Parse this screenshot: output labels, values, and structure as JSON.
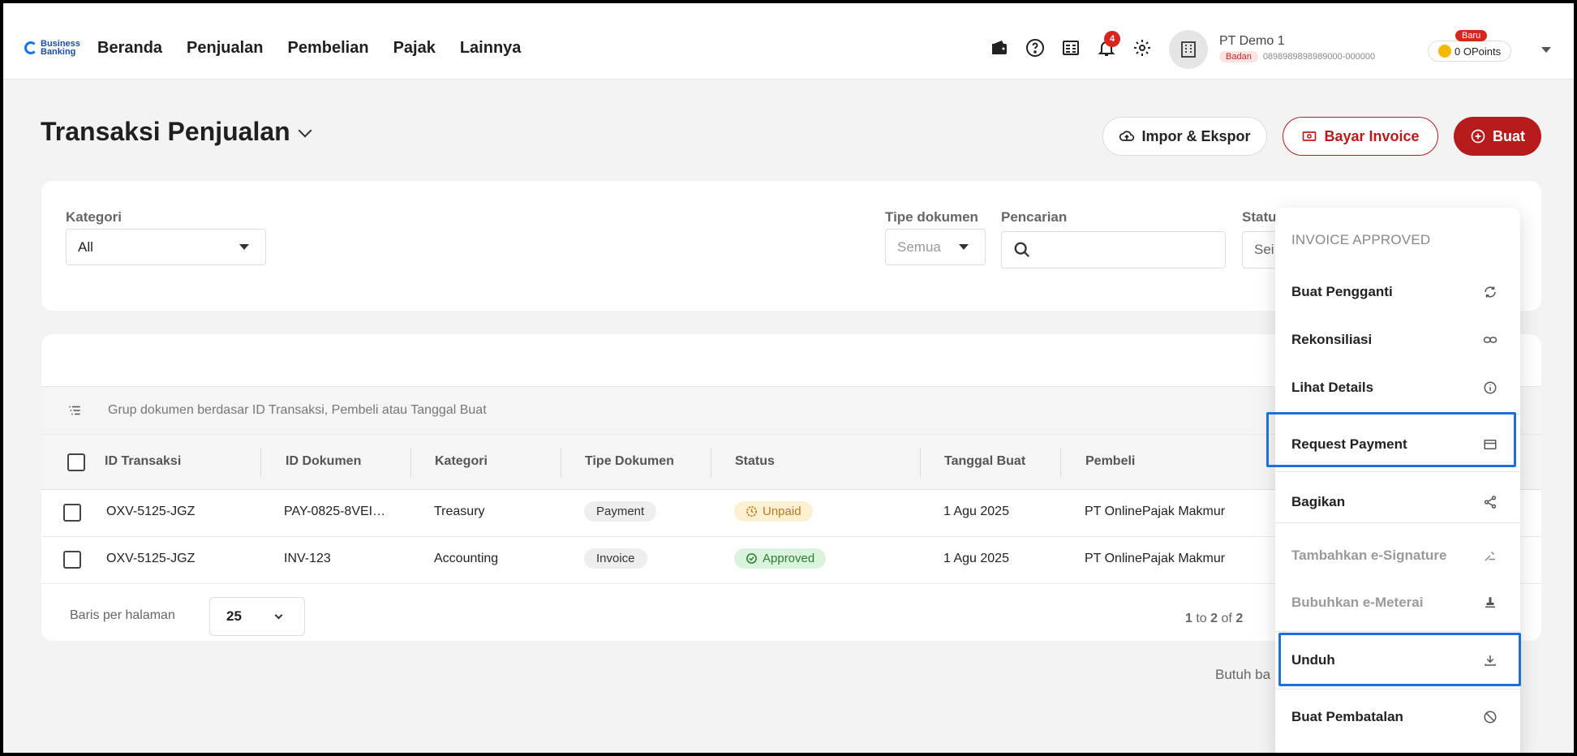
{
  "topbar": {
    "logo_line1": "Business",
    "logo_line2": "Banking",
    "nav": [
      "Beranda",
      "Penjualan",
      "Pembelian",
      "Pajak",
      "Lainnya"
    ],
    "notification_count": "4",
    "company_name": "PT Demo 1",
    "company_badge": "Badan",
    "company_npwp": "0898989898989000-000000",
    "points_badge": "Baru",
    "points_label": "0 OPoints"
  },
  "header": {
    "title": "Transaksi Penjualan",
    "impor_label": "Impor & Ekspor",
    "bayar_label": "Bayar Invoice",
    "buat_label": "Buat"
  },
  "filters": {
    "kategori_label": "Kategori",
    "kategori_value": "All",
    "tipe_label": "Tipe dokumen",
    "tipe_value": "Semua",
    "pencarian_label": "Pencarian",
    "pencarian_value": "",
    "status_label": "Statu",
    "status_value": "Sei"
  },
  "table": {
    "group_text": "Grup dokumen berdasar ID Transaksi, Pembeli atau Tanggal Buat",
    "headers": [
      "ID Transaksi",
      "ID Dokumen",
      "Kategori",
      "Tipe Dokumen",
      "Status",
      "Tanggal Buat",
      "Pembeli"
    ],
    "rows": [
      {
        "id_transaksi": "OXV-5125-JGZ",
        "id_dokumen": "PAY-0825-8VEI…",
        "kategori": "Treasury",
        "tipe": "Payment",
        "status": "Unpaid",
        "tanggal": "1 Agu 2025",
        "pembeli": "PT OnlinePajak Makmur"
      },
      {
        "id_transaksi": "OXV-5125-JGZ",
        "id_dokumen": "INV-123",
        "kategori": "Accounting",
        "tipe": "Invoice",
        "status": "Approved",
        "tanggal": "1 Agu 2025",
        "pembeli": "PT OnlinePajak Makmur"
      }
    ],
    "per_page_label": "Baris per halaman",
    "per_page_value": "25",
    "pager_from": "1",
    "pager_to": "2",
    "pager_total": "2",
    "pager_to_word": "to",
    "pager_of_word": "of"
  },
  "butuh_text": "Butuh ba",
  "menu": {
    "header": "INVOICE APPROVED",
    "items": [
      {
        "label": "Buat Pengganti",
        "icon": "refresh-icon"
      },
      {
        "label": "Rekonsiliasi",
        "icon": "link-icon"
      },
      {
        "label": "Lihat Details",
        "icon": "info-icon"
      },
      {
        "label": "Request Payment",
        "icon": "card-icon"
      },
      {
        "label": "Bagikan",
        "icon": "share-icon"
      },
      {
        "label": "Tambahkan e-Signature",
        "icon": "signature-icon"
      },
      {
        "label": "Bubuhkan e-Meterai",
        "icon": "stamp-icon"
      },
      {
        "label": "Unduh",
        "icon": "download-icon"
      },
      {
        "label": "Buat Pembatalan",
        "icon": "cancel-icon"
      }
    ]
  },
  "colors": {
    "brand_red": "#b71c1c",
    "highlight_blue": "#1e6fd9",
    "unpaid": "#b7791f",
    "approved": "#2e7d32"
  }
}
